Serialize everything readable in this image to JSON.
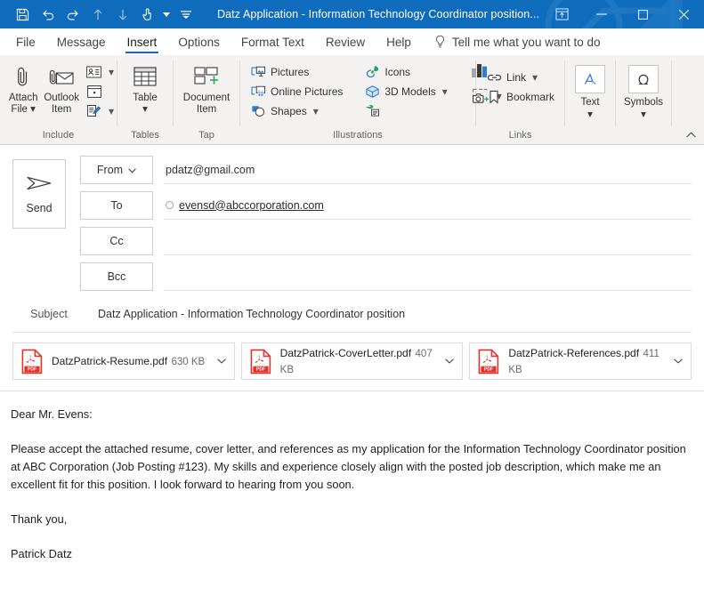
{
  "titlebar": {
    "title": "Datz Application - Information Technology Coordinator position...",
    "quick_access": [
      {
        "name": "save-icon",
        "label": "Save"
      },
      {
        "name": "undo-icon",
        "label": "Undo"
      },
      {
        "name": "redo-icon",
        "label": "Redo"
      },
      {
        "name": "move-up-icon",
        "label": "Previous Item"
      },
      {
        "name": "move-down-icon",
        "label": "Next Item"
      },
      {
        "name": "touch-mode-icon",
        "label": "Touch/Mouse Mode"
      },
      {
        "name": "customize-qat-icon",
        "label": "Customize Quick Access Toolbar"
      }
    ],
    "window_controls": [
      {
        "name": "ribbon-display-options",
        "label": "Ribbon Display Options"
      },
      {
        "name": "minimize-button",
        "label": "Minimize"
      },
      {
        "name": "maximize-button",
        "label": "Maximize"
      },
      {
        "name": "close-button",
        "label": "Close"
      }
    ],
    "accent_color": "#0f6cbd"
  },
  "tabs": [
    {
      "label": "File",
      "active": false
    },
    {
      "label": "Message",
      "active": false
    },
    {
      "label": "Insert",
      "active": true
    },
    {
      "label": "Options",
      "active": false
    },
    {
      "label": "Format Text",
      "active": false
    },
    {
      "label": "Review",
      "active": false
    },
    {
      "label": "Help",
      "active": false
    }
  ],
  "tell_me": {
    "placeholder": "Tell me what you want to do",
    "icon": "lightbulb-icon"
  },
  "ribbon": {
    "groups": [
      {
        "label": "Include",
        "big_buttons": [
          {
            "label_line1": "Attach",
            "label_line2": "File",
            "icon": "paperclip-icon",
            "has_dropdown": true
          },
          {
            "label_line1": "Outlook",
            "label_line2": "Item",
            "icon": "attach-item-icon",
            "has_dropdown": false
          }
        ],
        "icon_buttons": [
          {
            "name": "business-card-icon",
            "has_dropdown": true
          },
          {
            "name": "calendar-icon",
            "has_dropdown": false
          },
          {
            "name": "signature-icon",
            "has_dropdown": true
          }
        ]
      },
      {
        "label": "Tables",
        "big_buttons": [
          {
            "label_line1": "Table",
            "label_line2": "",
            "icon": "table-icon",
            "has_dropdown": true
          }
        ]
      },
      {
        "label": "Tap",
        "big_buttons": [
          {
            "label_line1": "Document",
            "label_line2": "Item",
            "icon": "document-item-icon",
            "has_dropdown": false
          }
        ]
      },
      {
        "label": "Illustrations",
        "small_buttons_col1": [
          {
            "label": "Pictures",
            "icon": "pictures-icon",
            "has_dropdown": false
          },
          {
            "label": "Online Pictures",
            "icon": "online-pictures-icon",
            "has_dropdown": false
          },
          {
            "label": "Shapes",
            "icon": "shapes-icon",
            "has_dropdown": true
          }
        ],
        "small_buttons_col2": [
          {
            "label": "Icons",
            "icon": "icons-icon",
            "has_dropdown": false
          },
          {
            "label": "3D Models",
            "icon": "3d-models-icon",
            "has_dropdown": true
          },
          {
            "label": "",
            "icon": "smartart-icon",
            "has_dropdown": false
          }
        ],
        "small_buttons_col3": [
          {
            "label": "",
            "icon": "chart-icon",
            "has_dropdown": false
          },
          {
            "label": "",
            "icon": "screenshot-icon",
            "has_dropdown": true
          }
        ]
      },
      {
        "label": "Links",
        "small_buttons_col1": [
          {
            "label": "Link",
            "icon": "link-icon",
            "has_dropdown": true
          },
          {
            "label": "Bookmark",
            "icon": "bookmark-icon",
            "has_dropdown": false
          }
        ]
      },
      {
        "label": "",
        "box_buttons": [
          {
            "label": "Text",
            "icon": "text-icon",
            "has_dropdown": true
          }
        ]
      },
      {
        "label": "",
        "box_buttons": [
          {
            "label": "Symbols",
            "icon": "omega-icon",
            "has_dropdown": true
          }
        ]
      }
    ],
    "collapse_label": "Collapse the Ribbon",
    "collapse_icon": "chevron-up-icon"
  },
  "compose": {
    "send_button": {
      "label": "Send",
      "icon": "send-arrow-icon"
    },
    "from": {
      "button_label": "From",
      "has_dropdown": true,
      "value": "pdatz@gmail.com"
    },
    "to": {
      "button_label": "To",
      "value": "evensd@abccorporation.com",
      "presence_icon": "presence-circle-icon"
    },
    "cc": {
      "button_label": "Cc",
      "value": ""
    },
    "bcc": {
      "button_label": "Bcc",
      "value": ""
    },
    "subject": {
      "label": "Subject",
      "value": "Datz Application - Information Technology Coordinator position"
    }
  },
  "attachments": [
    {
      "name": "DatzPatrick-Resume.pdf",
      "size": "630 KB",
      "icon": "pdf-file-icon",
      "chevron": "chevron-down-icon"
    },
    {
      "name": "DatzPatrick-CoverLetter.pdf",
      "size": "407 KB",
      "icon": "pdf-file-icon",
      "chevron": "chevron-down-icon"
    },
    {
      "name": "DatzPatrick-References.pdf",
      "size": "411 KB",
      "icon": "pdf-file-icon",
      "chevron": "chevron-down-icon"
    }
  ],
  "body": {
    "greeting": "Dear Mr. Evens:",
    "paragraph": "Please accept the attached resume, cover letter, and references as my application for the Information Technology Coordinator position at  ABC Corporation (Job Posting #123). My skills and experience closely align with the posted job description, which make me an excellent fit for this position. I look forward to hearing from you soon.",
    "closing": "Thank you,",
    "signature": "Patrick Datz"
  }
}
